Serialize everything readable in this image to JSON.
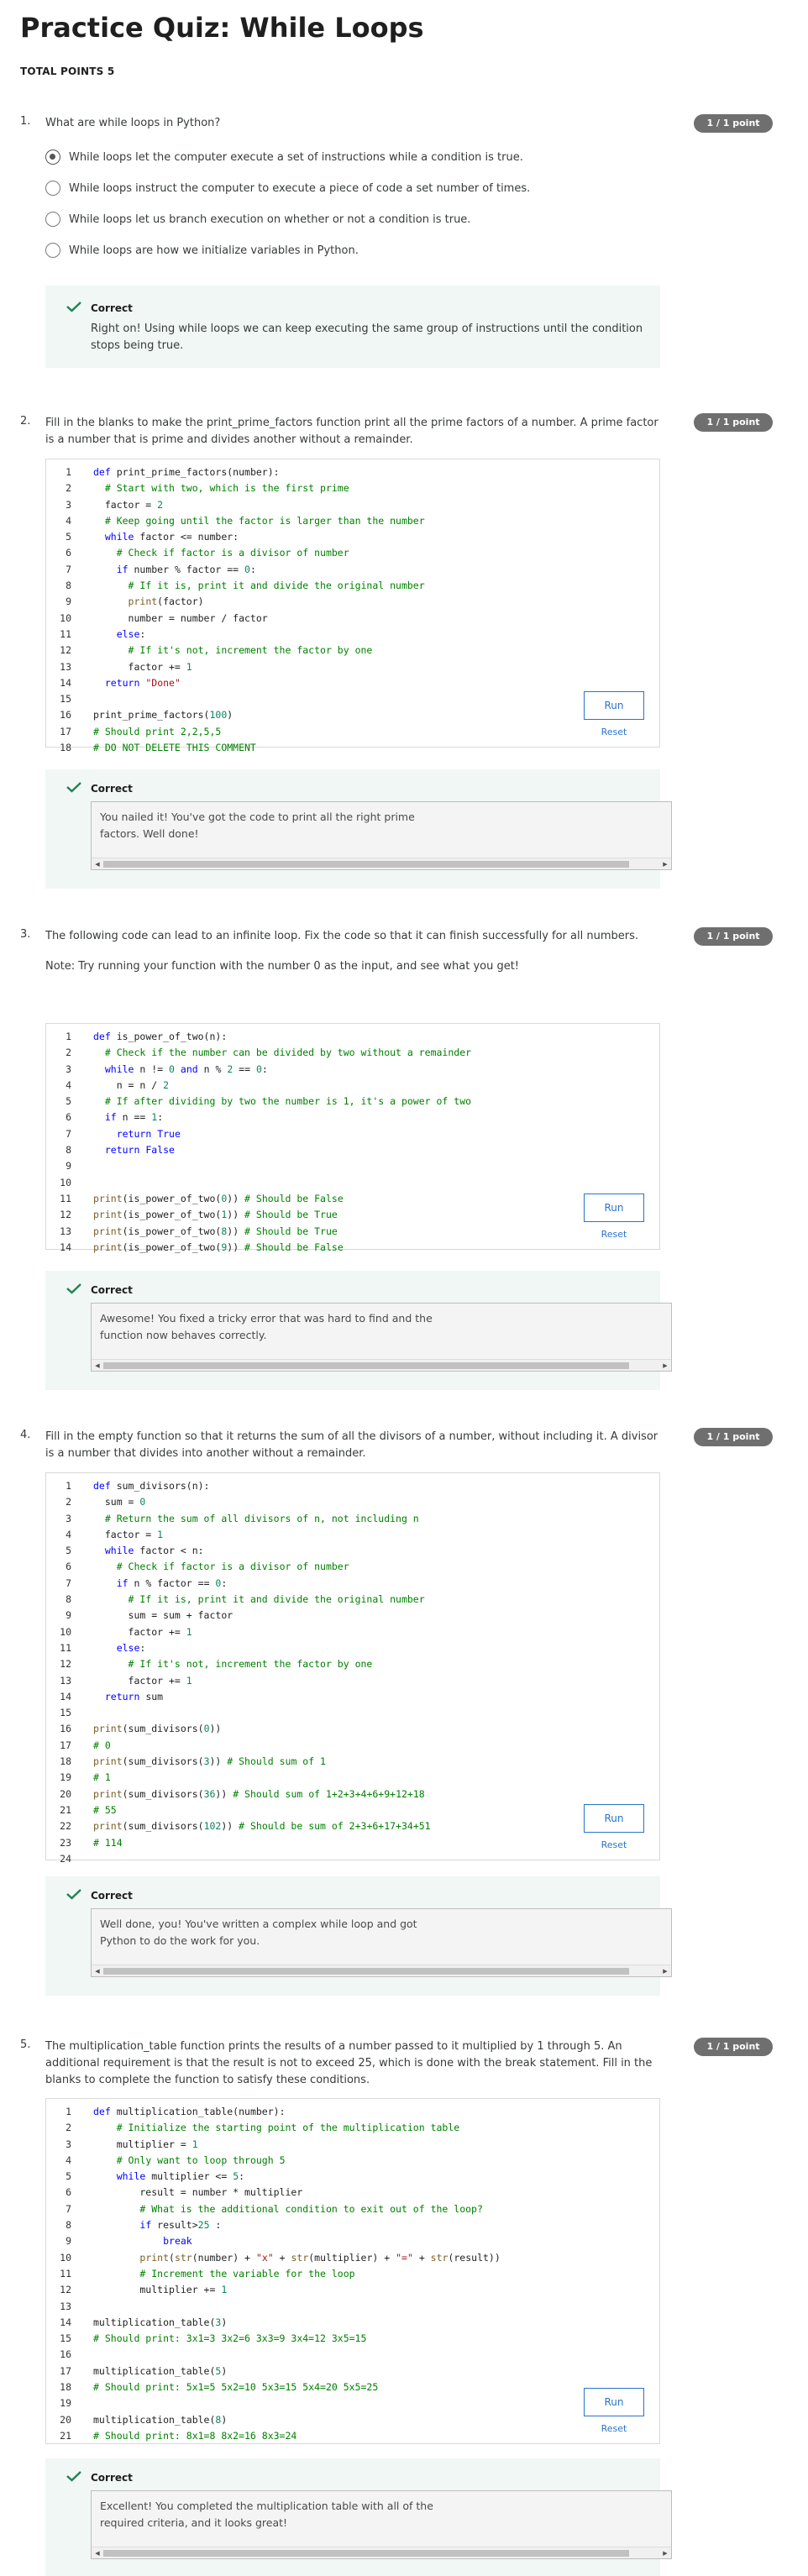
{
  "quiz": {
    "title": "Practice Quiz: While Loops",
    "total_points": "TOTAL POINTS 5"
  },
  "questions": [
    {
      "number": "1.",
      "prompt": [
        "What are while loops in Python?"
      ],
      "points": "1 / 1 point",
      "options": [
        {
          "label": "While loops let the computer execute a set of instructions while a condition is true.",
          "selected": true
        },
        {
          "label": "While loops instruct the computer to execute a piece of code a set number of times.",
          "selected": false
        },
        {
          "label": "While loops let us branch execution on whether or not a condition is true.",
          "selected": false
        },
        {
          "label": "While loops are how we initialize variables in Python.",
          "selected": false
        }
      ],
      "feedback": {
        "status": "Correct",
        "text": "Right on! Using while loops we can keep executing the same group of instructions until the condition stops being true."
      }
    },
    {
      "number": "2.",
      "prompt": [
        "Fill in the blanks to make the print_prime_factors function print all the prime factors of a number. A prime factor is a number that is prime and divides another without a remainder."
      ],
      "points": "1 / 1 point",
      "code": [
        "def print_prime_factors(number):",
        "  # Start with two, which is the first prime",
        "  factor = 2",
        "  # Keep going until the factor is larger than the number",
        "  while factor <= number:",
        "    # Check if factor is a divisor of number",
        "    if number % factor == 0:",
        "      # If it is, print it and divide the original number",
        "      print(factor)",
        "      number = number / factor",
        "    else:",
        "      # If it's not, increment the factor by one",
        "      factor += 1",
        "  return \"Done\"",
        "",
        "print_prime_factors(100)",
        "# Should print 2,2,5,5",
        "# DO NOT DELETE THIS COMMENT"
      ],
      "run_label": "Run",
      "reset_label": "Reset",
      "feedback": {
        "status": "Correct",
        "output": "You nailed it! You've got the code to print all the right prime factors. Well done!"
      }
    },
    {
      "number": "3.",
      "prompt": [
        "The following code can lead to an infinite loop. Fix the code so that it can finish successfully for all numbers.",
        "Note: Try running your function with the number 0 as the input, and see what you get!"
      ],
      "points": "1 / 1 point",
      "code": [
        "def is_power_of_two(n):",
        "  # Check if the number can be divided by two without a remainder",
        "  while n != 0 and n % 2 == 0:",
        "    n = n / 2",
        "  # If after dividing by two the number is 1, it's a power of two",
        "  if n == 1:",
        "    return True",
        "  return False",
        "",
        "",
        "print(is_power_of_two(0)) # Should be False",
        "print(is_power_of_two(1)) # Should be True",
        "print(is_power_of_two(8)) # Should be True",
        "print(is_power_of_two(9)) # Should be False"
      ],
      "run_label": "Run",
      "reset_label": "Reset",
      "feedback": {
        "status": "Correct",
        "output": "Awesome! You fixed a tricky error that was hard to find and the function now behaves correctly."
      }
    },
    {
      "number": "4.",
      "prompt": [
        "Fill in the empty function so that it returns the sum of all the divisors of a number, without including it. A divisor is a number that divides into another without a remainder."
      ],
      "points": "1 / 1 point",
      "code": [
        "def sum_divisors(n):",
        "  sum = 0",
        "  # Return the sum of all divisors of n, not including n",
        "  factor = 1",
        "  while factor < n:",
        "    # Check if factor is a divisor of number",
        "    if n % factor == 0:",
        "      # If it is, print it and divide the original number",
        "      sum = sum + factor",
        "      factor += 1",
        "    else:",
        "      # If it's not, increment the factor by one",
        "      factor += 1",
        "  return sum",
        "",
        "print(sum_divisors(0))",
        "# 0",
        "print(sum_divisors(3)) # Should sum of 1",
        "# 1",
        "print(sum_divisors(36)) # Should sum of 1+2+3+4+6+9+12+18",
        "# 55",
        "print(sum_divisors(102)) # Should be sum of 2+3+6+17+34+51",
        "# 114",
        ""
      ],
      "run_label": "Run",
      "reset_label": "Reset",
      "feedback": {
        "status": "Correct",
        "output": "Well done, you! You've written a complex while loop and got Python to do the work for you."
      }
    },
    {
      "number": "5.",
      "prompt": [
        "The multiplication_table function prints the results of a number passed to it multiplied by 1 through 5. An additional requirement is that the result is not to exceed 25, which is done with the break statement. Fill in the blanks to complete the function to satisfy these conditions."
      ],
      "points": "1 / 1 point",
      "code": [
        "def multiplication_table(number):",
        "    # Initialize the starting point of the multiplication table",
        "    multiplier = 1",
        "    # Only want to loop through 5",
        "    while multiplier <= 5:",
        "        result = number * multiplier",
        "        # What is the additional condition to exit out of the loop?",
        "        if result>25 :",
        "            break",
        "        print(str(number) + \"x\" + str(multiplier) + \"=\" + str(result))",
        "        # Increment the variable for the loop",
        "        multiplier += 1",
        "",
        "multiplication_table(3)",
        "# Should print: 3x1=3 3x2=6 3x3=9 3x4=12 3x5=15",
        "",
        "multiplication_table(5)",
        "# Should print: 5x1=5 5x2=10 5x3=15 5x4=20 5x5=25",
        "",
        "multiplication_table(8)",
        "# Should print: 8x1=8 8x2=16 8x3=24"
      ],
      "run_label": "Run",
      "reset_label": "Reset",
      "feedback": {
        "status": "Correct",
        "output": "Excellent! You completed the multiplication table with all of the required criteria, and it looks great!"
      }
    }
  ],
  "colors": {
    "keyword": "#0000ff",
    "comment": "#008000",
    "number": "#098658",
    "string": "#a31515",
    "builtin": "#795e26",
    "badge": "#6f6f6f",
    "correct_bg": "#f0f7f4",
    "check": "#1f8354",
    "link": "#2a73cc"
  },
  "icons": {
    "feedback": "checkmark-icon",
    "radio": "radio-button",
    "scroll_left": "triangle-left-icon",
    "scroll_right": "triangle-right-icon"
  }
}
